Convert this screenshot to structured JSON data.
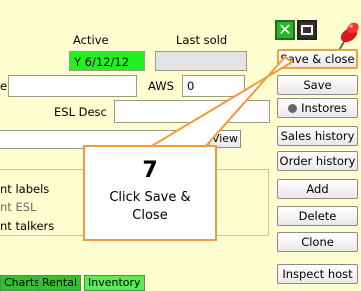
{
  "form": {
    "active_label": "Active",
    "active_value": "Y 6/12/12",
    "last_sold_label": "Last sold",
    "last_sold_value": "",
    "partial_label_left": "e",
    "aws_label": "AWS",
    "aws_value": "0",
    "esl_desc_label": "ESL Desc",
    "esl_desc_value": "",
    "view_label": "View",
    "checkbox_texts": [
      "nt labels",
      "nt ESL",
      "nt talkers"
    ]
  },
  "buttons": {
    "save_close": "Save & close",
    "save": "Save",
    "instores": "Instores",
    "sales_history": "Sales history",
    "order_history": "Order history",
    "add": "Add",
    "delete": "Delete",
    "clone": "Clone",
    "inspect_host": "Inspect host"
  },
  "tabs": [
    "Charts",
    "Rental",
    "Inventory"
  ],
  "callout": {
    "step": "7",
    "text": "Click Save & Close"
  },
  "colors": {
    "background": "#fefed0",
    "active_field": "#21f021",
    "callout_border": "#f39a3c",
    "tab_green": "#2ec42e"
  }
}
